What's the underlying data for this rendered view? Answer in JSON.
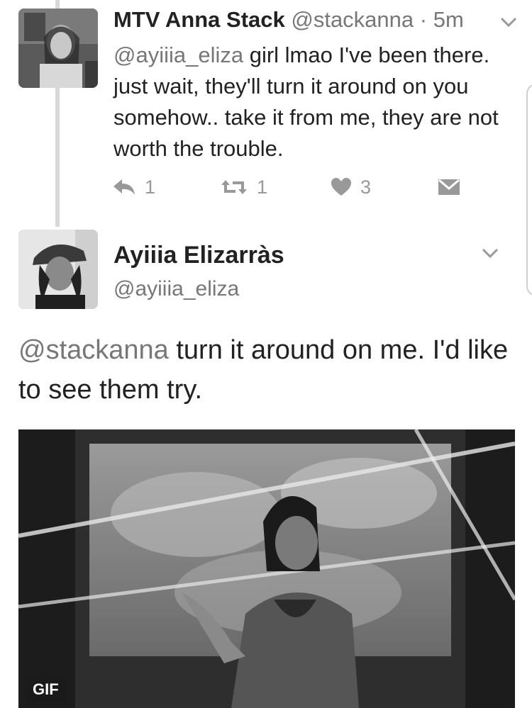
{
  "reply_tweet": {
    "display_name": "MTV Anna Stack",
    "handle": "@stackanna",
    "separator": "·",
    "time": "5m",
    "mention": "@ayiiia_eliza",
    "text": " girl lmao I've been there. just wait, they'll turn it around on you somehow.. take it from me, they are not worth the trouble.",
    "actions": {
      "reply_count": "1",
      "retweet_count": "1",
      "like_count": "3"
    },
    "icons": [
      "reply-icon",
      "retweet-icon",
      "heart-icon",
      "dm-icon",
      "chevron-down-icon"
    ]
  },
  "main_tweet": {
    "display_name": "Ayiiia Elizarràs",
    "handle": "@ayiiia_eliza",
    "mention": "@stackanna",
    "text": " turn it around on me. I'd like to see them try.",
    "media": {
      "badge": "GIF"
    }
  },
  "colors": {
    "text": "#222222",
    "muted": "#777777",
    "action_gray": "#999999",
    "thread_line": "#d8d8d8"
  }
}
